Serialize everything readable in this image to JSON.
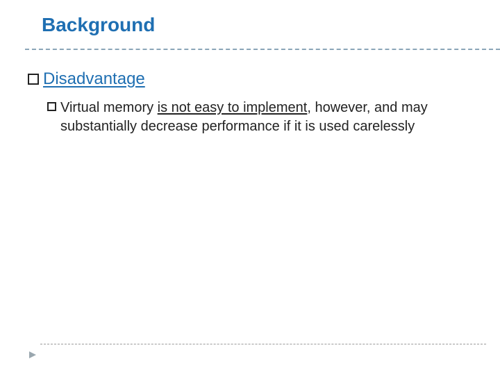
{
  "title": "Background",
  "level1": {
    "label": "Disadvantage"
  },
  "level2": {
    "prefix": "Virtual memory ",
    "underlined": "is not easy to implement",
    "suffix": ", however, and may substantially decrease performance if it is used carelessly"
  }
}
